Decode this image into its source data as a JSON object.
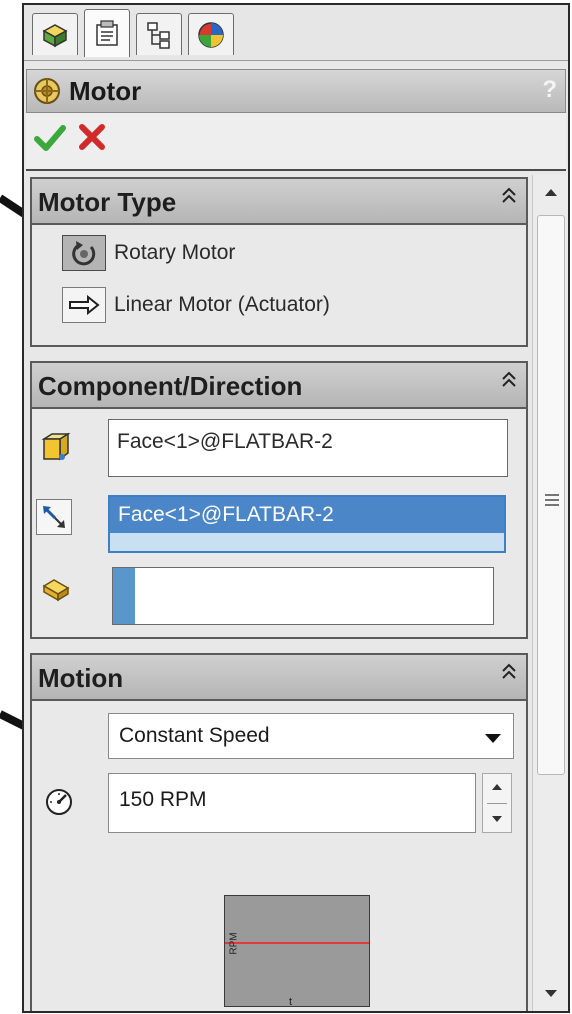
{
  "tabs": [
    {
      "icon": "feature-manager-icon"
    },
    {
      "icon": "property-manager-icon"
    },
    {
      "icon": "configuration-manager-icon"
    },
    {
      "icon": "display-manager-icon"
    }
  ],
  "panel": {
    "title": "Motor",
    "help": "?"
  },
  "motor_type": {
    "header": "Motor Type",
    "options": [
      {
        "label": "Rotary Motor",
        "selected": true
      },
      {
        "label": "Linear Motor (Actuator)",
        "selected": false
      }
    ]
  },
  "component_direction": {
    "header": "Component/Direction",
    "location_value": "Face<1>@FLATBAR-2",
    "direction_value": "Face<1>@FLATBAR-2",
    "relative_value": ""
  },
  "motion": {
    "header": "Motion",
    "function": "Constant Speed",
    "speed": "150 RPM",
    "graph_ylabel": "RPM",
    "graph_xlabel": "t"
  },
  "colors": {
    "accent": "#3f7fc4",
    "selection": "#4a86c8",
    "graph_line": "#e23a3a"
  }
}
